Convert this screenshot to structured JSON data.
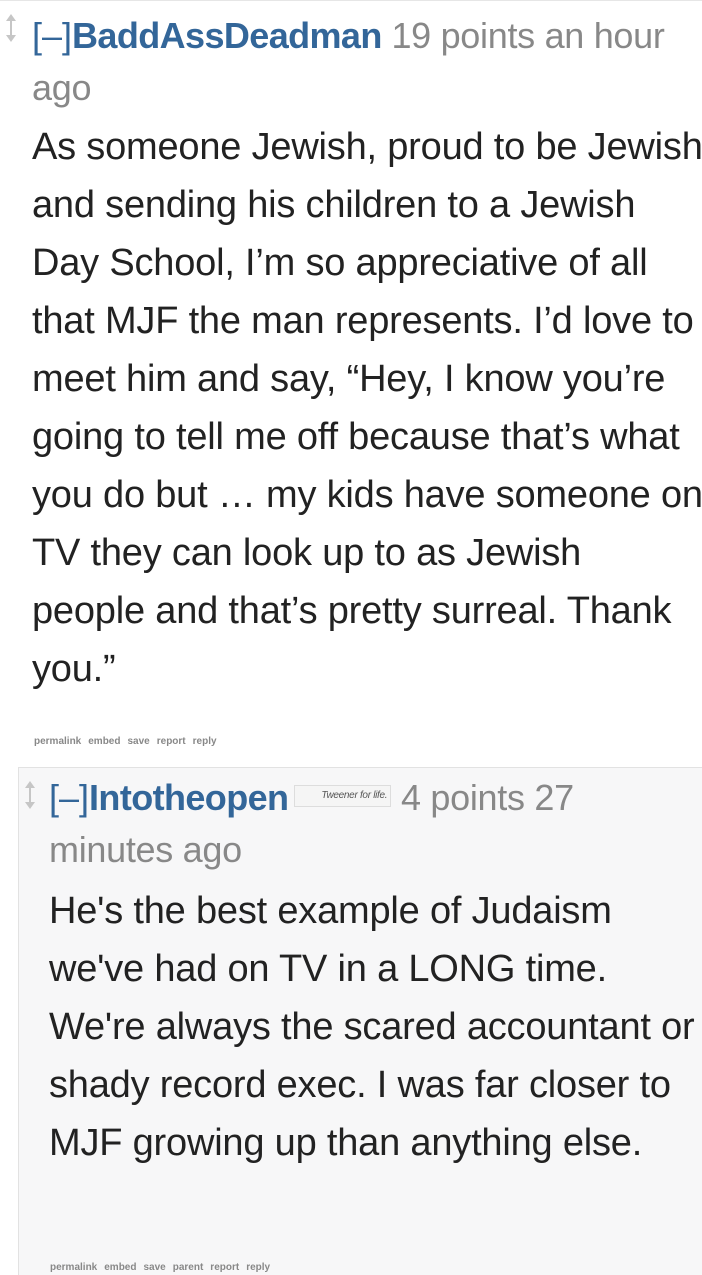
{
  "comments": [
    {
      "expand": "[–]",
      "author": "BaddAssDeadman",
      "flair": "",
      "score": "19 points",
      "time": "an hour ago",
      "body": "As someone Jewish, proud to be Jewish and sending his children to a Jewish Day School, I’m so appreciative of all that MJF the man represents. I’d love to meet him and say, “Hey, I know you’re going to tell me off because that’s what you do but … my kids have someone on TV they can look up to as Jewish people and that’s pretty surreal. Thank you.”",
      "buttons": {
        "permalink": "permalink",
        "embed": "embed",
        "save": "save",
        "report": "report",
        "reply": "reply"
      }
    },
    {
      "expand": "[–]",
      "author": "Intotheopen",
      "flair": "Tweener for life.",
      "score": "4 points",
      "time": "27 minutes ago",
      "body": "He's the best example of Judaism we've had on TV in a LONG time. We're always the scared accountant or shady record exec. I was far closer to MJF growing up than anything else.",
      "buttons": {
        "permalink": "permalink",
        "embed": "embed",
        "save": "save",
        "parent": "parent",
        "report": "report",
        "reply": "reply"
      }
    }
  ],
  "icons": {
    "vote": "vote-arrows-icon"
  },
  "colors": {
    "author": "#336699",
    "meta": "#888888",
    "body": "#222222",
    "nested_bg": "#f7f7f8"
  }
}
